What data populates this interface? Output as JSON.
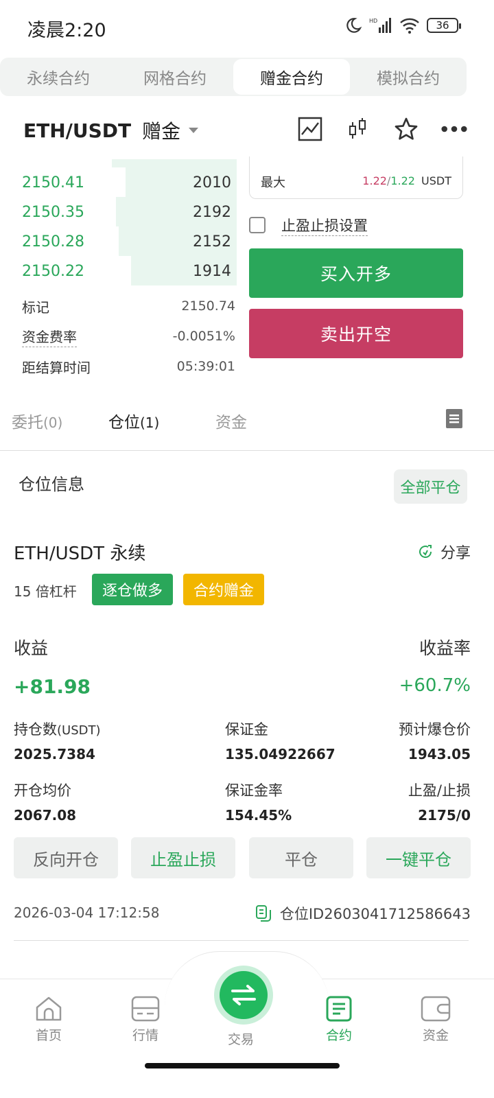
{
  "status_bar": {
    "time": "凌晨2:20",
    "battery": "36"
  },
  "top_tabs": [
    {
      "label": "永续合约",
      "active": false
    },
    {
      "label": "网格合约",
      "active": false
    },
    {
      "label": "赠金合约",
      "active": true
    },
    {
      "label": "模拟合约",
      "active": false
    }
  ],
  "header": {
    "pair": "ETH/USDT",
    "mode": "赠金"
  },
  "order_book": {
    "rows": [
      {
        "price": "2150.41",
        "qty": "2010",
        "depth": 0.47
      },
      {
        "price": "2150.35",
        "qty": "2192",
        "depth": 0.51
      },
      {
        "price": "2150.28",
        "qty": "2152",
        "depth": 0.5
      },
      {
        "price": "2150.22",
        "qty": "1914",
        "depth": 0.45
      }
    ],
    "mark_label": "标记",
    "mark_value": "2150.74",
    "funding_label": "资金费率",
    "funding_value": "-0.0051%",
    "settle_label": "距结算时间",
    "settle_value": "05:39:01"
  },
  "order_panel": {
    "max_label": "最大",
    "max_a": "1.22",
    "max_sep": "/",
    "max_b": "1.22",
    "max_unit": "USDT",
    "tpsl_label": "止盈止损设置",
    "buy_label": "买入开多",
    "sell_label": "卖出开空"
  },
  "sub_tabs": {
    "orders": "委托",
    "orders_count": "(0)",
    "positions": "仓位",
    "positions_count": "(1)",
    "funds": "资金"
  },
  "positions": {
    "section_title": "仓位信息",
    "close_all": "全部平仓",
    "pair": "ETH/USDT",
    "type": "永续",
    "share": "分享",
    "leverage_num": "15",
    "leverage_text": "倍杠杆",
    "tag_side": "逐仓做多",
    "tag_bonus": "合约赠金",
    "pnl_label": "收益",
    "pnl_rate_label": "收益率",
    "pnl_value": "+81.98",
    "pnl_rate_value": "+60.7%",
    "size_label": "持仓数",
    "size_unit": "(USDT)",
    "size_value": "2025.7384",
    "margin_label": "保证金",
    "margin_value": "135.04922667",
    "liq_label": "预计爆仓价",
    "liq_value": "1943.05",
    "entry_label": "开仓均价",
    "entry_value": "2067.08",
    "margin_rate_label": "保证金率",
    "margin_rate_value": "154.45%",
    "tpsl_label": "止盈/止损",
    "tpsl_value": "2175/0",
    "actions": [
      "反向开仓",
      "止盈止损",
      "平仓",
      "一键平仓"
    ],
    "date": "2026-03-04 17:12:58",
    "id_label": "仓位ID",
    "id_value": "2603041712586643"
  },
  "bottom_nav": [
    {
      "label": "首页",
      "icon": "home-icon"
    },
    {
      "label": "行情",
      "icon": "market-icon"
    },
    {
      "label": "交易",
      "icon": "swap-icon"
    },
    {
      "label": "合约",
      "icon": "contract-icon",
      "active": true
    },
    {
      "label": "资金",
      "icon": "wallet-icon"
    }
  ],
  "colors": {
    "green": "#2aa75a",
    "red": "#c63d63",
    "yellow": "#f2b600"
  }
}
